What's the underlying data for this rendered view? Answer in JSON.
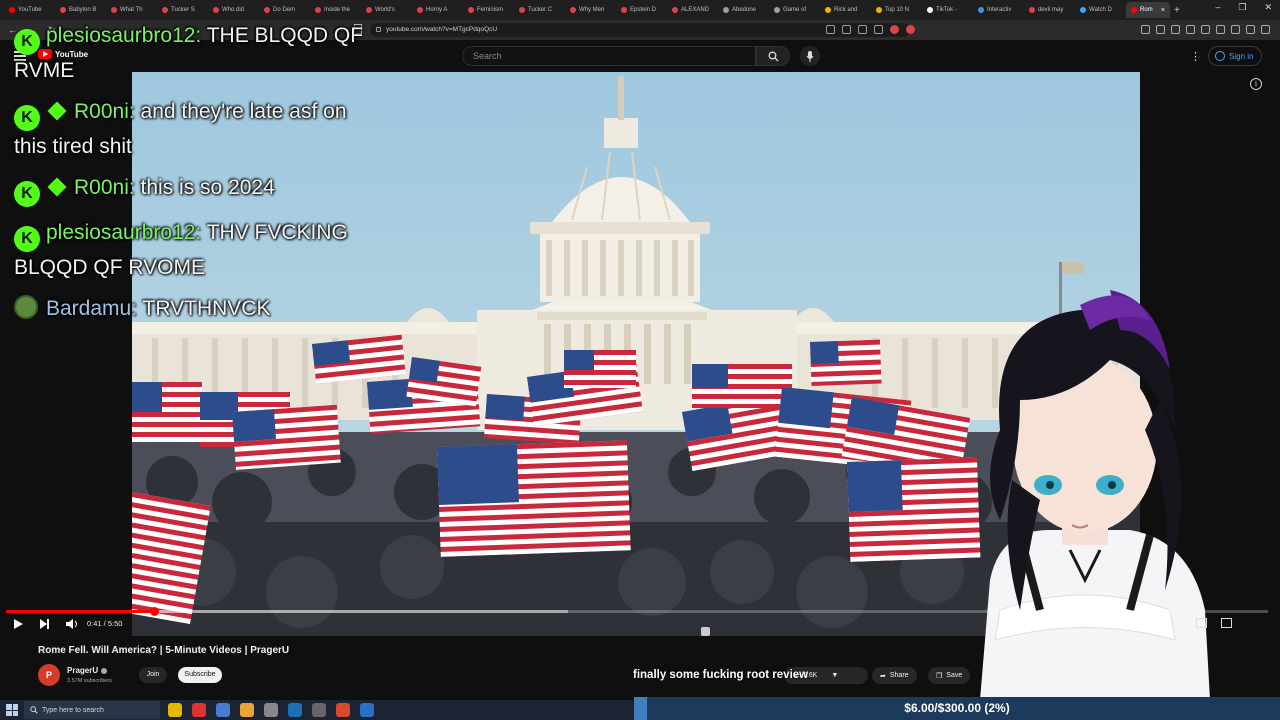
{
  "browser": {
    "tabs": [
      {
        "label": "YouTube",
        "color": "#ff0000"
      },
      {
        "label": "Babylon B",
        "color": "#e04343"
      },
      {
        "label": "What Th",
        "color": "#e04343"
      },
      {
        "label": "Tucker S",
        "color": "#e04343"
      },
      {
        "label": "Who did",
        "color": "#e04343"
      },
      {
        "label": "Do Dem",
        "color": "#e04343"
      },
      {
        "label": "Inside the",
        "color": "#e04343"
      },
      {
        "label": "World's",
        "color": "#e04343"
      },
      {
        "label": "Horny A",
        "color": "#e04343"
      },
      {
        "label": "Feminism",
        "color": "#e04343"
      },
      {
        "label": "Tucker C",
        "color": "#e04343"
      },
      {
        "label": "Why Men",
        "color": "#e04343"
      },
      {
        "label": "Epstein D",
        "color": "#e04343"
      },
      {
        "label": "ALEXAND",
        "color": "#e04343"
      },
      {
        "label": "Abedone",
        "color": "#9aa0a6"
      },
      {
        "label": "Game of",
        "color": "#9aa0a6"
      },
      {
        "label": "Rick and",
        "color": "#f0b400"
      },
      {
        "label": "Top 10 N",
        "color": "#f0b400"
      },
      {
        "label": "TikTok -",
        "color": "#ffffff"
      },
      {
        "label": "Interactiv",
        "color": "#4a90e2"
      },
      {
        "label": "devil may",
        "color": "#e04343"
      },
      {
        "label": "Watch D",
        "color": "#3ea6ff"
      }
    ],
    "active_tab": "Rom",
    "url": "youtube.com/watch?v=MTgcPdqoQcU"
  },
  "youtube": {
    "logo_text": "YouTube",
    "search_placeholder": "Search",
    "sign_in": "Sign in"
  },
  "player": {
    "time": "0:41 / 5:50",
    "progress_fraction": 0.117,
    "buffered_fraction": 0.445
  },
  "video": {
    "title": "Rome Fell. Will America? | 5-Minute Videos | PragerU",
    "channel": "PragerU",
    "channel_initial": "P",
    "subscribers": "3.57M subscribers",
    "join": "Join",
    "subscribe": "Subscribe",
    "like_count": "3.6K",
    "share": "Share",
    "save": "Save"
  },
  "chat": {
    "messages": [
      {
        "user": "plesiosaurbro12:",
        "text": " THE BLQQD QF RVME",
        "badges": [
          "kick"
        ]
      },
      {
        "user": "R00ni:",
        "text": " and they're late asf on this tired shit",
        "badges": [
          "kick",
          "diamond"
        ]
      },
      {
        "user": "R00ni:",
        "text": " this is so 2024",
        "badges": [
          "kick",
          "diamond"
        ]
      },
      {
        "user": "plesiosaurbro12:",
        "text": " THV FVCKING BLQQD QF RVOME",
        "badges": [
          "kick"
        ]
      },
      {
        "user": "Bardamu:",
        "text": " TRVTHNVCK",
        "badges": [
          "pepe"
        ]
      }
    ]
  },
  "overlay": {
    "caption": "finally some fucking root review",
    "goal_text": "$6.00/$300.00 (2%)",
    "goal_fraction": 0.02
  },
  "taskbar": {
    "search_placeholder": "Type here to search"
  },
  "colors": {
    "kick_green": "#53fc18",
    "youtube_red": "#ff0000",
    "link_blue": "#3ea6ff"
  }
}
